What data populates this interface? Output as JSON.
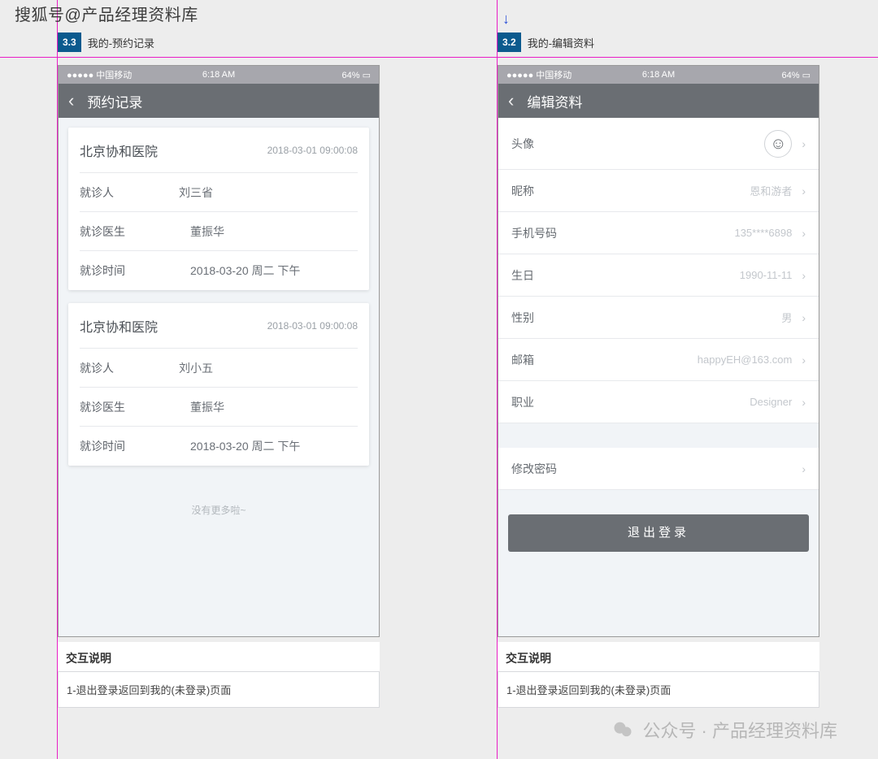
{
  "watermark_top": "搜狐号@产品经理资料库",
  "watermark_bottom": "公众号 · 产品经理资料库",
  "left": {
    "badge": "3.3",
    "title": "我的-预约记录",
    "status": {
      "carrier": "中国移动",
      "time": "6:18 AM",
      "battery": "64%"
    },
    "nav_title": "预约记录",
    "cards": [
      {
        "hospital": "北京协和医院",
        "created": "2018-03-01 09:00:08",
        "rows": [
          {
            "label": "就诊人",
            "value": "刘三省"
          },
          {
            "label": "就诊医生",
            "value": "董振华"
          },
          {
            "label": "就诊时间",
            "value": "2018-03-20 周二 下午"
          }
        ]
      },
      {
        "hospital": "北京协和医院",
        "created": "2018-03-01 09:00:08",
        "rows": [
          {
            "label": "就诊人",
            "value": "刘小五"
          },
          {
            "label": "就诊医生",
            "value": "董振华"
          },
          {
            "label": "就诊时间",
            "value": "2018-03-20 周二 下午"
          }
        ]
      }
    ],
    "nomore": "没有更多啦~",
    "desc_title": "交互说明",
    "desc_note": "1-退出登录返回到我的(未登录)页面"
  },
  "right": {
    "badge": "3.2",
    "title": "我的-编辑资料",
    "status": {
      "carrier": "中国移动",
      "time": "6:18 AM",
      "battery": "64%"
    },
    "nav_title": "编辑资料",
    "rows": {
      "avatar": "头像",
      "nickname_label": "昵称",
      "nickname_value": "恩和游者",
      "phone_label": "手机号码",
      "phone_value": "135****6898",
      "birth_label": "生日",
      "birth_value": "1990-11-11",
      "gender_label": "性别",
      "gender_value": "男",
      "email_label": "邮箱",
      "email_value": "happyEH@163.com",
      "job_label": "职业",
      "job_value": "Designer",
      "pwd_label": "修改密码"
    },
    "logout": "退出登录",
    "desc_title": "交互说明",
    "desc_note": "1-退出登录返回到我的(未登录)页面"
  }
}
